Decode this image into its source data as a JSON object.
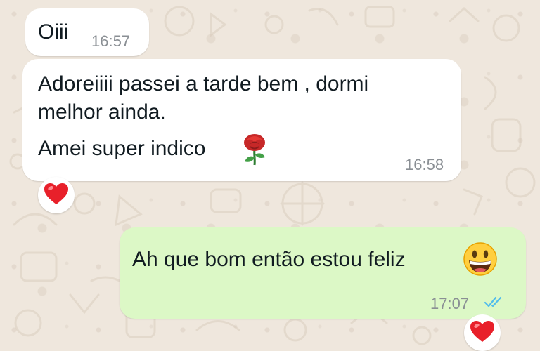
{
  "messages": [
    {
      "direction": "incoming",
      "lines": [
        "Oiii"
      ],
      "time": "16:57"
    },
    {
      "direction": "incoming",
      "lines": [
        "Adoreiiii passei a tarde bem , dormi",
        "melhor ainda.",
        "Amei super indico"
      ],
      "emoji": "rose-emoji",
      "time": "16:58",
      "reaction": "heart-emoji"
    },
    {
      "direction": "outgoing",
      "lines": [
        "Ah que bom então estou feliz"
      ],
      "emoji": "grinning-face-emoji",
      "time": "17:07",
      "status": "read-double-check",
      "reaction": "heart-emoji"
    }
  ],
  "colors": {
    "incoming_bubble": "#ffffff",
    "outgoing_bubble": "#dcf8c6",
    "read_ticks": "#53bdeb",
    "wallpaper": "#efe7dd"
  }
}
